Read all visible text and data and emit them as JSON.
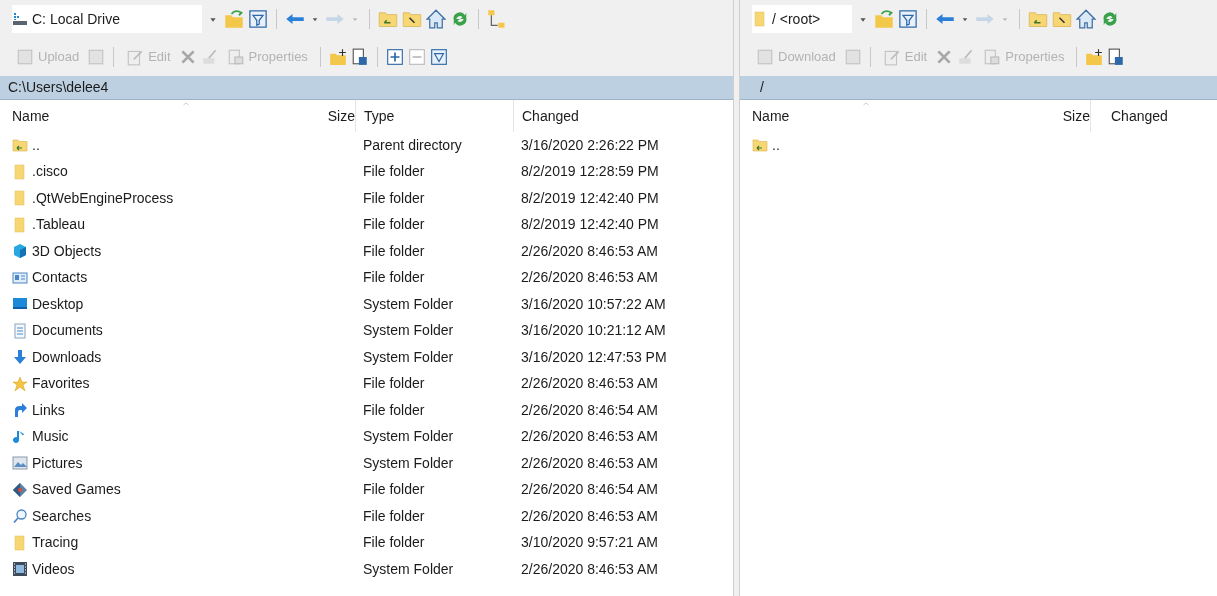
{
  "panels": [
    {
      "drive": "C: Local Drive",
      "kind": "drive",
      "text_buttons": [
        {
          "label": "Upload",
          "disabled": true
        },
        {
          "label": "Edit",
          "disabled": true
        },
        {
          "label": "Properties",
          "disabled": true
        }
      ],
      "path": "C:\\Users\\delee4",
      "columns": [
        {
          "label": "Name",
          "kind": "name"
        },
        {
          "label": "Size",
          "kind": "size"
        },
        {
          "label": "Type",
          "kind": "type"
        },
        {
          "label": "Changed",
          "kind": "changed"
        }
      ],
      "rows": [
        {
          "name": "..",
          "kind": "parent",
          "type": "Parent directory",
          "changed": "3/16/2020 2:26:22 PM"
        },
        {
          "name": ".cisco",
          "kind": "folder",
          "type": "File folder",
          "changed": "8/2/2019 12:28:59 PM"
        },
        {
          "name": ".QtWebEngineProcess",
          "kind": "folder",
          "type": "File folder",
          "changed": "8/2/2019 12:42:40 PM"
        },
        {
          "name": ".Tableau",
          "kind": "folder",
          "type": "File folder",
          "changed": "8/2/2019 12:42:40 PM"
        },
        {
          "name": "3D Objects",
          "kind": "cube",
          "type": "File folder",
          "changed": "2/26/2020 8:46:53 AM"
        },
        {
          "name": "Contacts",
          "kind": "contacts",
          "type": "File folder",
          "changed": "2/26/2020 8:46:53 AM"
        },
        {
          "name": "Desktop",
          "kind": "desktop",
          "type": "System Folder",
          "changed": "3/16/2020 10:57:22 AM"
        },
        {
          "name": "Documents",
          "kind": "documents",
          "type": "System Folder",
          "changed": "3/16/2020 10:21:12 AM"
        },
        {
          "name": "Downloads",
          "kind": "downloads",
          "type": "System Folder",
          "changed": "3/16/2020 12:47:53 PM"
        },
        {
          "name": "Favorites",
          "kind": "star",
          "type": "File folder",
          "changed": "2/26/2020 8:46:53 AM"
        },
        {
          "name": "Links",
          "kind": "links",
          "type": "File folder",
          "changed": "2/26/2020 8:46:54 AM"
        },
        {
          "name": "Music",
          "kind": "music",
          "type": "System Folder",
          "changed": "2/26/2020 8:46:53 AM"
        },
        {
          "name": "Pictures",
          "kind": "pictures",
          "type": "System Folder",
          "changed": "2/26/2020 8:46:53 AM"
        },
        {
          "name": "Saved Games",
          "kind": "games",
          "type": "File folder",
          "changed": "2/26/2020 8:46:54 AM"
        },
        {
          "name": "Searches",
          "kind": "search",
          "type": "File folder",
          "changed": "2/26/2020 8:46:53 AM"
        },
        {
          "name": "Tracing",
          "kind": "folder",
          "type": "File folder",
          "changed": "3/10/2020 9:57:21 AM"
        },
        {
          "name": "Videos",
          "kind": "videos",
          "type": "System Folder",
          "changed": "2/26/2020 8:46:53 AM"
        }
      ]
    },
    {
      "drive": "/ <root>",
      "kind": "folder",
      "text_buttons": [
        {
          "label": "Download",
          "disabled": true
        },
        {
          "label": "Edit",
          "disabled": true
        },
        {
          "label": "Properties",
          "disabled": true
        }
      ],
      "path": "/",
      "columns": [
        {
          "label": "Name",
          "kind": "name"
        },
        {
          "label": "Size",
          "kind": "size"
        },
        {
          "label": "Changed",
          "kind": "changed"
        }
      ],
      "rows": [
        {
          "name": "..",
          "kind": "parent"
        }
      ]
    }
  ]
}
